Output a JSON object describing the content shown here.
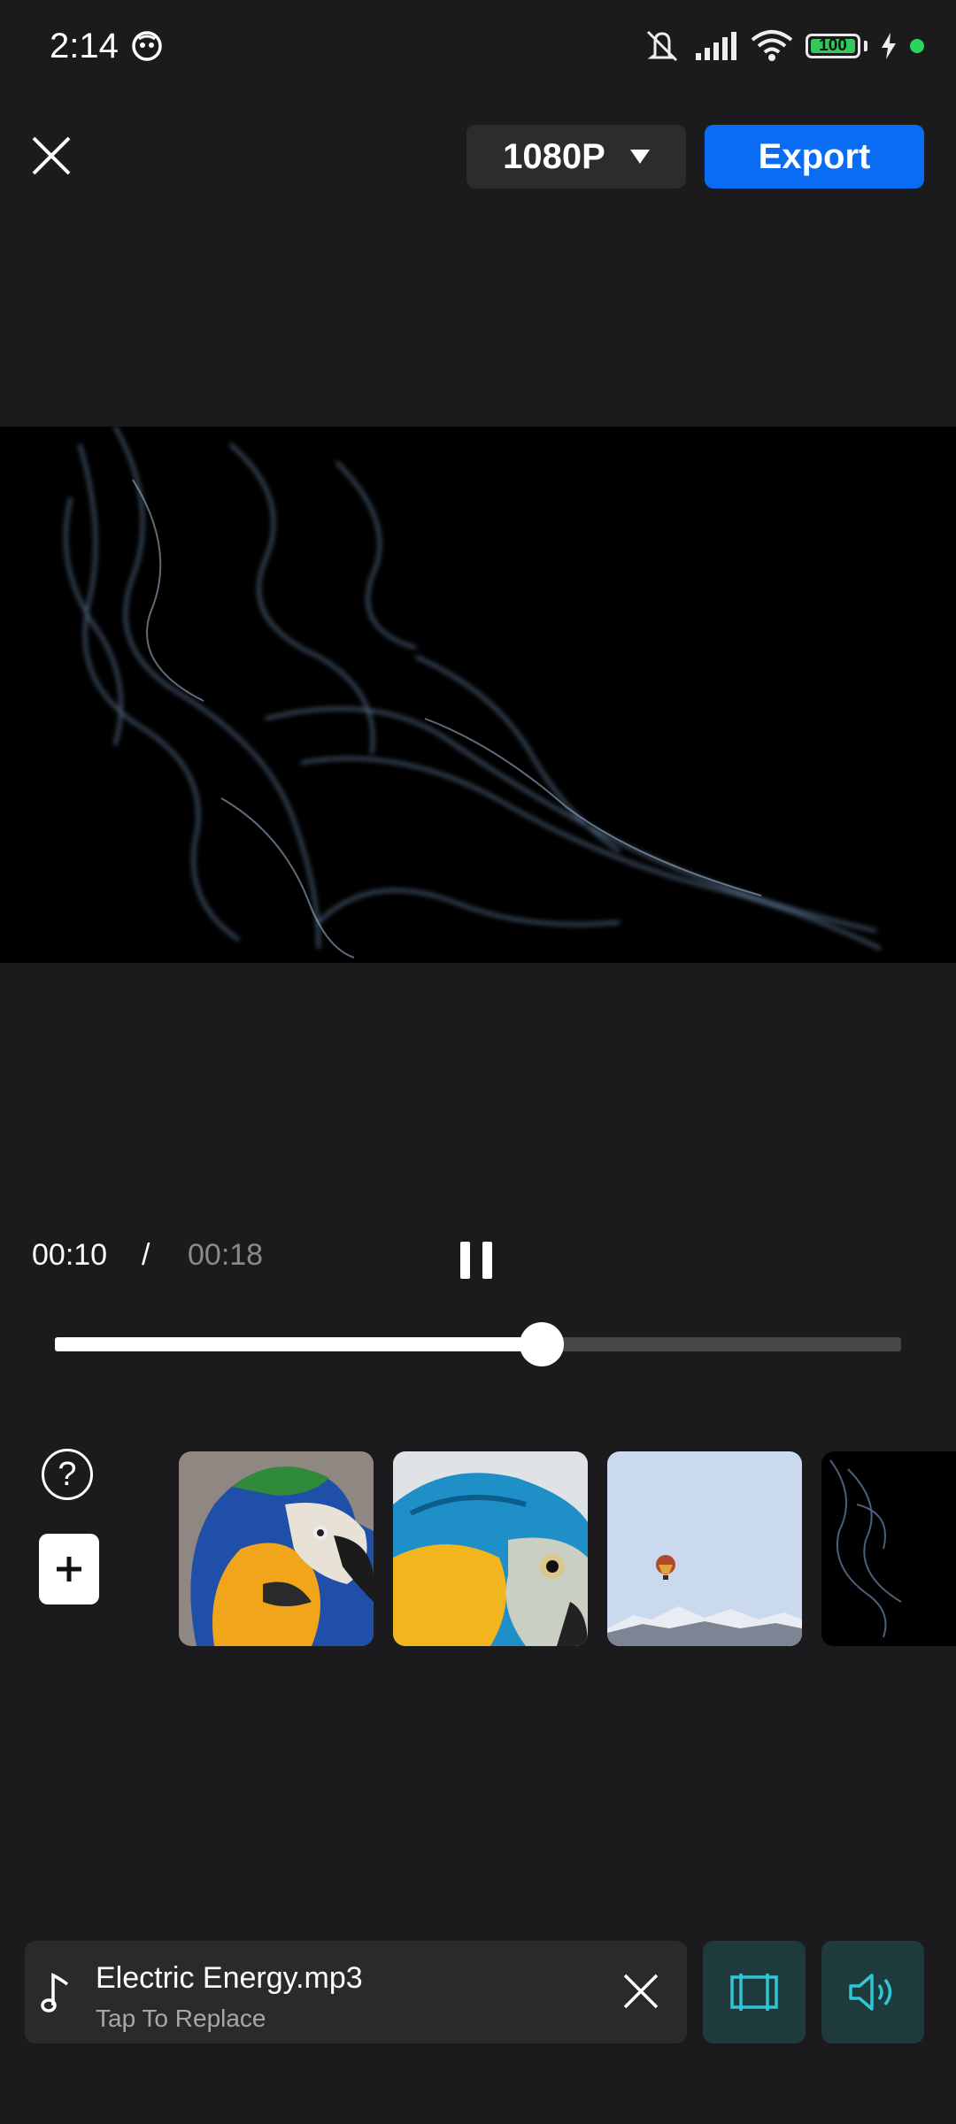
{
  "status_bar": {
    "time": "2:14",
    "battery_level": "100",
    "battery_fraction": 1.0
  },
  "top_bar": {
    "resolution_label": "1080P",
    "export_label": "Export"
  },
  "playback": {
    "current_time": "00:10",
    "separator": "/",
    "total_time": "00:18",
    "progress_fraction": 0.575
  },
  "timeline": {
    "help_symbol": "?",
    "clips": [
      "macaw-1",
      "macaw-2",
      "hot-air-balloon",
      "smoke"
    ]
  },
  "audio": {
    "file_name": "Electric Energy.mp3",
    "hint": "Tap To Replace"
  },
  "colors": {
    "accent": "#0a6cf2",
    "background": "#1b1b1d",
    "tool_button_bg": "#1f3a3c",
    "tool_icon": "#2fc7d6"
  },
  "icons": {
    "close": "close-icon",
    "dropdown": "triangle-down-icon",
    "pause": "pause-icon",
    "help": "help-circle-icon",
    "add": "plus-icon",
    "music": "music-note-icon",
    "crop": "crop-frame-icon",
    "volume": "volume-icon"
  }
}
